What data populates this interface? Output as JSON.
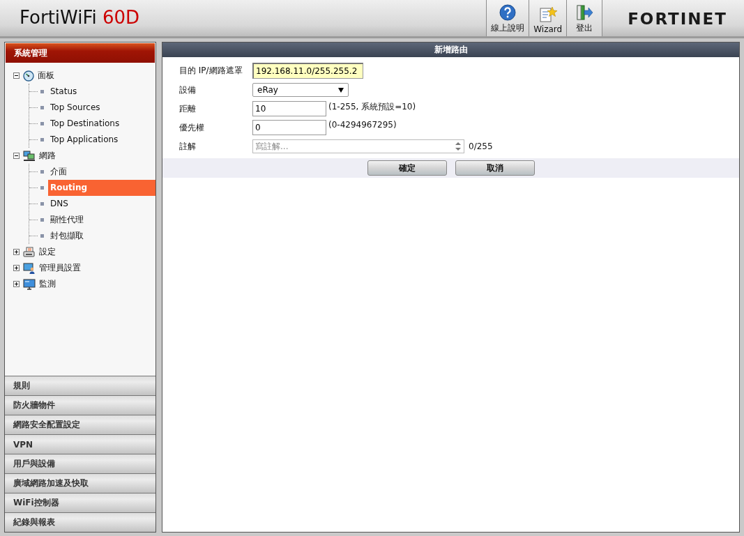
{
  "header": {
    "product": "FortiWiFi",
    "model": "60D",
    "toolbar": [
      {
        "kind": "help",
        "label": "線上說明"
      },
      {
        "kind": "wizard",
        "label": "Wizard"
      },
      {
        "kind": "logout",
        "label": "登出"
      }
    ],
    "logo": "FORTINET"
  },
  "sidebar": {
    "active_section": "系統管理",
    "tree": [
      {
        "label": "面板",
        "kind": "dashboard",
        "expanded": true,
        "children": [
          {
            "label": "Status",
            "selected": false
          },
          {
            "label": "Top Sources",
            "selected": false
          },
          {
            "label": "Top Destinations",
            "selected": false
          },
          {
            "label": "Top Applications",
            "selected": false
          }
        ]
      },
      {
        "label": "網路",
        "kind": "network",
        "expanded": true,
        "children": [
          {
            "label": "介面",
            "selected": false
          },
          {
            "label": "Routing",
            "selected": true
          },
          {
            "label": "DNS",
            "selected": false
          },
          {
            "label": "顯性代理",
            "selected": false
          },
          {
            "label": "封包擷取",
            "selected": false
          }
        ]
      },
      {
        "label": "設定",
        "kind": "config",
        "expanded": false
      },
      {
        "label": "管理員設置",
        "kind": "admin",
        "expanded": false
      },
      {
        "label": "監測",
        "kind": "monitor",
        "expanded": false
      }
    ],
    "sections": [
      "規則",
      "防火牆物件",
      "網路安全配置設定",
      "VPN",
      "用戶與設備",
      "廣域網路加速及快取",
      "WiFi控制器",
      "紀錄與報表"
    ]
  },
  "form": {
    "title": "新增路由",
    "fields": [
      {
        "kind": "text",
        "label": "目的 IP/網路遮罩",
        "value": "192.168.11.0/255.255.2",
        "highlighted": true
      },
      {
        "kind": "select",
        "label": "設備",
        "value": "eRay",
        "highlighted": false
      },
      {
        "kind": "text",
        "label": "距離",
        "value": "10",
        "hint": "(1-255, 系統預設=10)",
        "highlighted": false
      },
      {
        "kind": "text",
        "label": "優先權",
        "value": "0",
        "hint": "(0-4294967295)",
        "highlighted": false
      },
      {
        "kind": "textarea",
        "label": "註解",
        "placeholder": "寫註解...",
        "counter": "0/255",
        "highlighted": false
      }
    ],
    "buttons": [
      "確定",
      "取消"
    ]
  }
}
